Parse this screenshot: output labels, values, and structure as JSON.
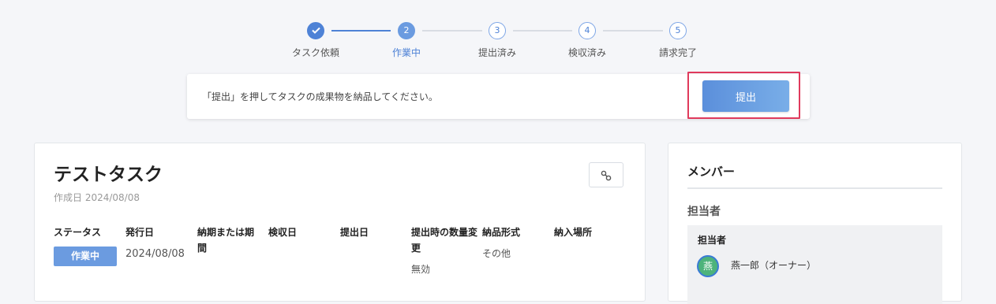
{
  "stepper": {
    "steps": [
      {
        "number": "",
        "label": "タスク依頼",
        "state": "done"
      },
      {
        "number": "2",
        "label": "作業中",
        "state": "active"
      },
      {
        "number": "3",
        "label": "提出済み",
        "state": "todo"
      },
      {
        "number": "4",
        "label": "検収済み",
        "state": "todo"
      },
      {
        "number": "5",
        "label": "請求完了",
        "state": "todo"
      }
    ]
  },
  "submit_panel": {
    "message": "「提出」を押してタスクの成果物を納品してください。",
    "button_label": "提出"
  },
  "task": {
    "title": "テストタスク",
    "created": "作成日 2024/08/08",
    "columns": {
      "status": {
        "header": "ステータス",
        "value": "作業中"
      },
      "issue_date": {
        "header": "発行日",
        "value": "2024/08/08"
      },
      "deadline": {
        "header": "納期または期間",
        "value": ""
      },
      "inspection_date": {
        "header": "検収日",
        "value": ""
      },
      "submit_date": {
        "header": "提出日",
        "value": ""
      },
      "quantity_change": {
        "header": "提出時の数量変更",
        "value": "無効"
      },
      "delivery_format": {
        "header": "納品形式",
        "value": "その他"
      },
      "delivery_place": {
        "header": "納入場所",
        "value": ""
      }
    }
  },
  "members": {
    "title": "メンバー",
    "section_label": "担当者",
    "box_label": "担当者",
    "assignee": {
      "avatar_char": "燕",
      "name": "燕一郎（オーナー）"
    }
  },
  "colors": {
    "accent": "#4e82d6",
    "highlight": "#e03a5c",
    "avatar_bg": "#4db37b"
  }
}
